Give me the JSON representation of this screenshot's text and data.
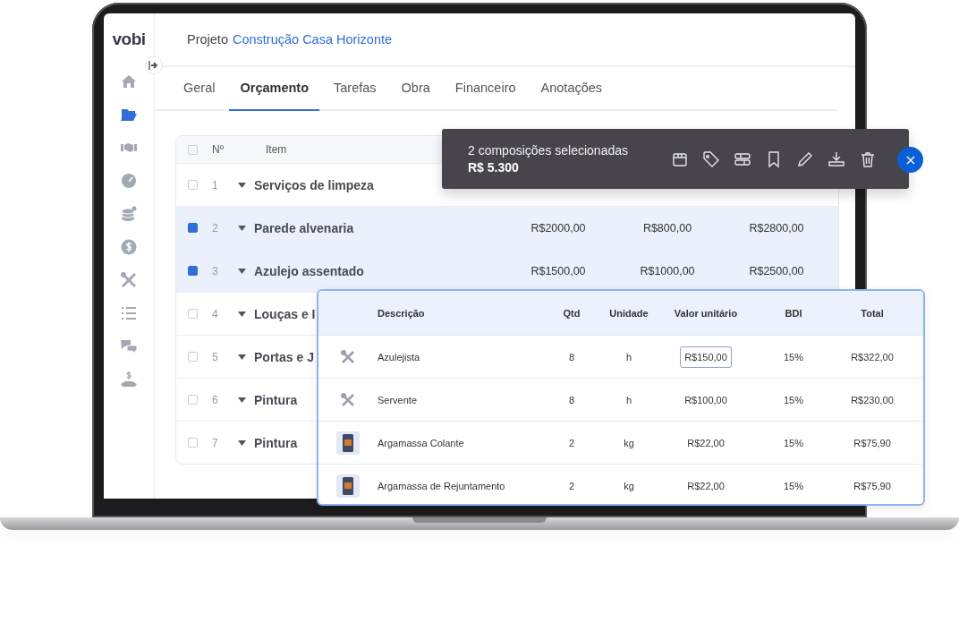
{
  "logo": "vobi",
  "sidebar": {
    "items": [
      {
        "kind": "home",
        "selected": false
      },
      {
        "kind": "folder",
        "selected": true
      },
      {
        "kind": "handshake",
        "selected": false
      },
      {
        "kind": "gauge",
        "selected": false
      },
      {
        "kind": "coins",
        "selected": false
      },
      {
        "kind": "dollar",
        "selected": false
      },
      {
        "kind": "tools",
        "selected": false
      },
      {
        "kind": "list",
        "selected": false
      },
      {
        "kind": "chat",
        "selected": false
      },
      {
        "kind": "payment",
        "selected": false
      }
    ]
  },
  "header": {
    "label": "Projeto",
    "project": "Construção Casa Horizonte"
  },
  "tabs": [
    {
      "label": "Geral",
      "selected": false
    },
    {
      "label": "Orçamento",
      "selected": true
    },
    {
      "label": "Tarefas",
      "selected": false
    },
    {
      "label": "Obra",
      "selected": false
    },
    {
      "label": "Financeiro",
      "selected": false
    },
    {
      "label": "Anotações",
      "selected": false
    }
  ],
  "table": {
    "columns": [
      "Nº",
      "Item"
    ],
    "all_checked": false,
    "rows": [
      {
        "number": "1",
        "item": "Serviços de limpeza",
        "selected": false,
        "values": []
      },
      {
        "number": "2",
        "item": "Parede alvenaria",
        "selected": true,
        "values": [
          "R$2000,00",
          "R$800,00",
          "R$2800,00"
        ]
      },
      {
        "number": "3",
        "item": "Azulejo assentado",
        "selected": true,
        "values": [
          "R$1500,00",
          "R$1000,00",
          "R$2500,00"
        ]
      },
      {
        "number": "4",
        "item": "Louças e I",
        "selected": false,
        "values": []
      },
      {
        "number": "5",
        "item": "Portas e J",
        "selected": false,
        "values": []
      },
      {
        "number": "6",
        "item": "Pintura",
        "selected": false,
        "values": []
      },
      {
        "number": "7",
        "item": "Pintura",
        "selected": false,
        "values": []
      }
    ]
  },
  "selection_bar": {
    "title": "2 composições selecionadas",
    "total": "R$ 5.300"
  },
  "compositions": {
    "columns": [
      "Descrição",
      "Qtd",
      "Unidade",
      "Valor unitário",
      "BDI",
      "Total"
    ],
    "rows": [
      {
        "kind": "labor",
        "description": "Azulejista",
        "qty": "8",
        "unit": "h",
        "unit_value": "R$150,00",
        "editing": true,
        "bdi": "15%",
        "total": "R$322,00"
      },
      {
        "kind": "labor",
        "description": "Servente",
        "qty": "8",
        "unit": "h",
        "unit_value": "R$100,00",
        "editing": false,
        "bdi": "15%",
        "total": "R$230,00"
      },
      {
        "kind": "material",
        "description": "Argamassa Colante",
        "qty": "2",
        "unit": "kg",
        "unit_value": "R$22,00",
        "editing": false,
        "bdi": "15%",
        "total": "R$75,90"
      },
      {
        "kind": "material",
        "description": "Argamassa de Rejuntamento",
        "qty": "2",
        "unit": "kg",
        "unit_value": "R$22,00",
        "editing": false,
        "bdi": "15%",
        "total": "R$75,90"
      }
    ]
  }
}
